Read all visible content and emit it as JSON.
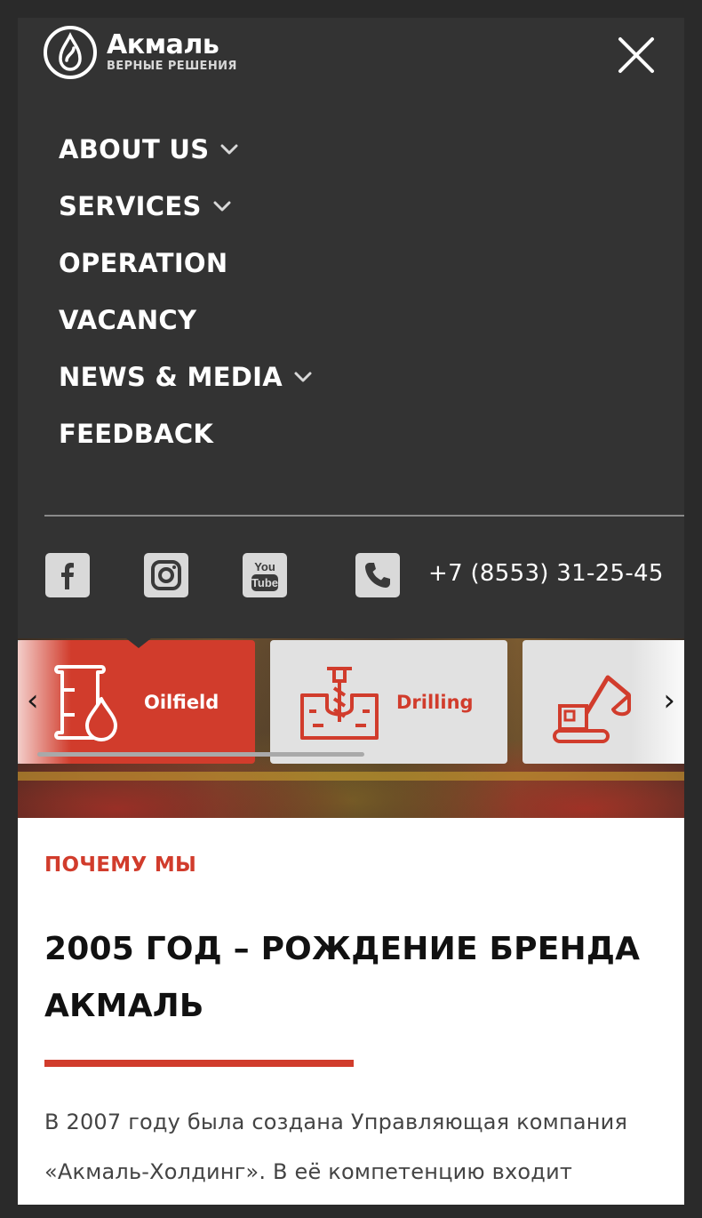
{
  "logo": {
    "name": "Акмаль",
    "tagline": "ВЕРНЫЕ РЕШЕНИЯ"
  },
  "menu": {
    "items": [
      {
        "label": "ABOUT US",
        "has_submenu": true
      },
      {
        "label": "SERVICES",
        "has_submenu": true
      },
      {
        "label": "OPERATION",
        "has_submenu": false
      },
      {
        "label": "VACANCY",
        "has_submenu": false
      },
      {
        "label": "NEWS & MEDIA",
        "has_submenu": true
      },
      {
        "label": "FEEDBACK",
        "has_submenu": false
      }
    ]
  },
  "contacts": {
    "social": [
      "facebook-icon",
      "instagram-icon",
      "youtube-icon"
    ],
    "phone": "+7 (8553) 31-25-45"
  },
  "services_carousel": {
    "cards": [
      {
        "label": "Oilfield",
        "icon": "oil-barrel-icon",
        "active": true
      },
      {
        "label": "Drilling",
        "icon": "drill-rig-icon",
        "active": false
      },
      {
        "label": "",
        "icon": "excavator-icon",
        "active": false
      }
    ]
  },
  "section": {
    "eyebrow": "ПОЧЕМУ МЫ",
    "heading_line1": "2005 ГОД – РОЖДЕНИЕ БРЕНДА",
    "heading_line2": "АКМАЛЬ",
    "paragraph_line1": "В 2007 году была создана Управляющая компания",
    "paragraph_line2": "«Акмаль-Холдинг». В её компетенцию входит"
  },
  "colors": {
    "accent": "#d13c2c",
    "menu_bg": "#333333",
    "card_inactive": "#e1e1e1"
  }
}
